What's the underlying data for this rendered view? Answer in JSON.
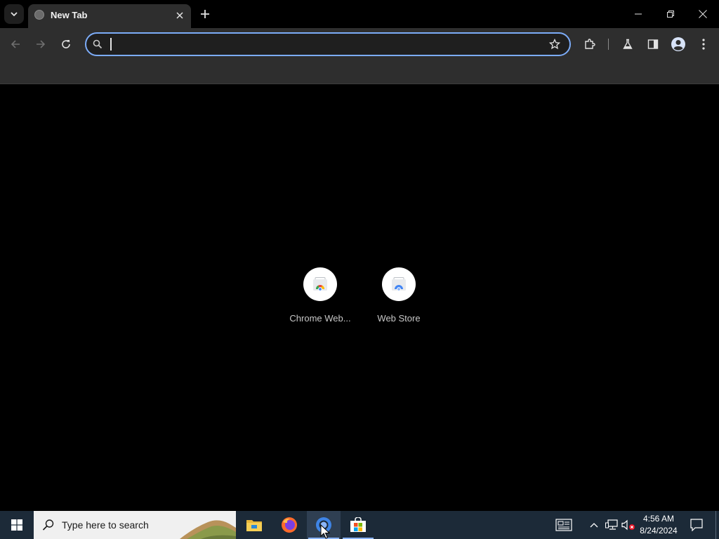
{
  "browser": {
    "tab": {
      "title": "New Tab"
    },
    "omnibox": {
      "value": "",
      "placeholder": ""
    }
  },
  "shortcuts": [
    {
      "label": "Chrome Web..."
    },
    {
      "label": "Web Store"
    }
  ],
  "taskbar": {
    "search_placeholder": "Type here to search",
    "time": "4:56 AM",
    "date": "8/24/2024"
  },
  "colors": {
    "accent": "#7cacf8",
    "toolbar": "#2e2e2e",
    "taskbar": "#1c2a38"
  },
  "icons": [
    "tab-search-icon",
    "globe-icon",
    "close-icon",
    "plus-icon",
    "minimize-icon",
    "restore-icon",
    "back-icon",
    "forward-icon",
    "reload-icon",
    "search-icon",
    "star-icon",
    "extensions-icon",
    "labs-icon",
    "side-panel-icon",
    "profile-icon",
    "menu-icon",
    "windows-logo-icon",
    "file-explorer-icon",
    "firefox-icon",
    "chrome-icon",
    "store-icon",
    "news-icon",
    "chevron-up-icon",
    "network-icon",
    "volume-muted-icon",
    "notification-icon"
  ]
}
